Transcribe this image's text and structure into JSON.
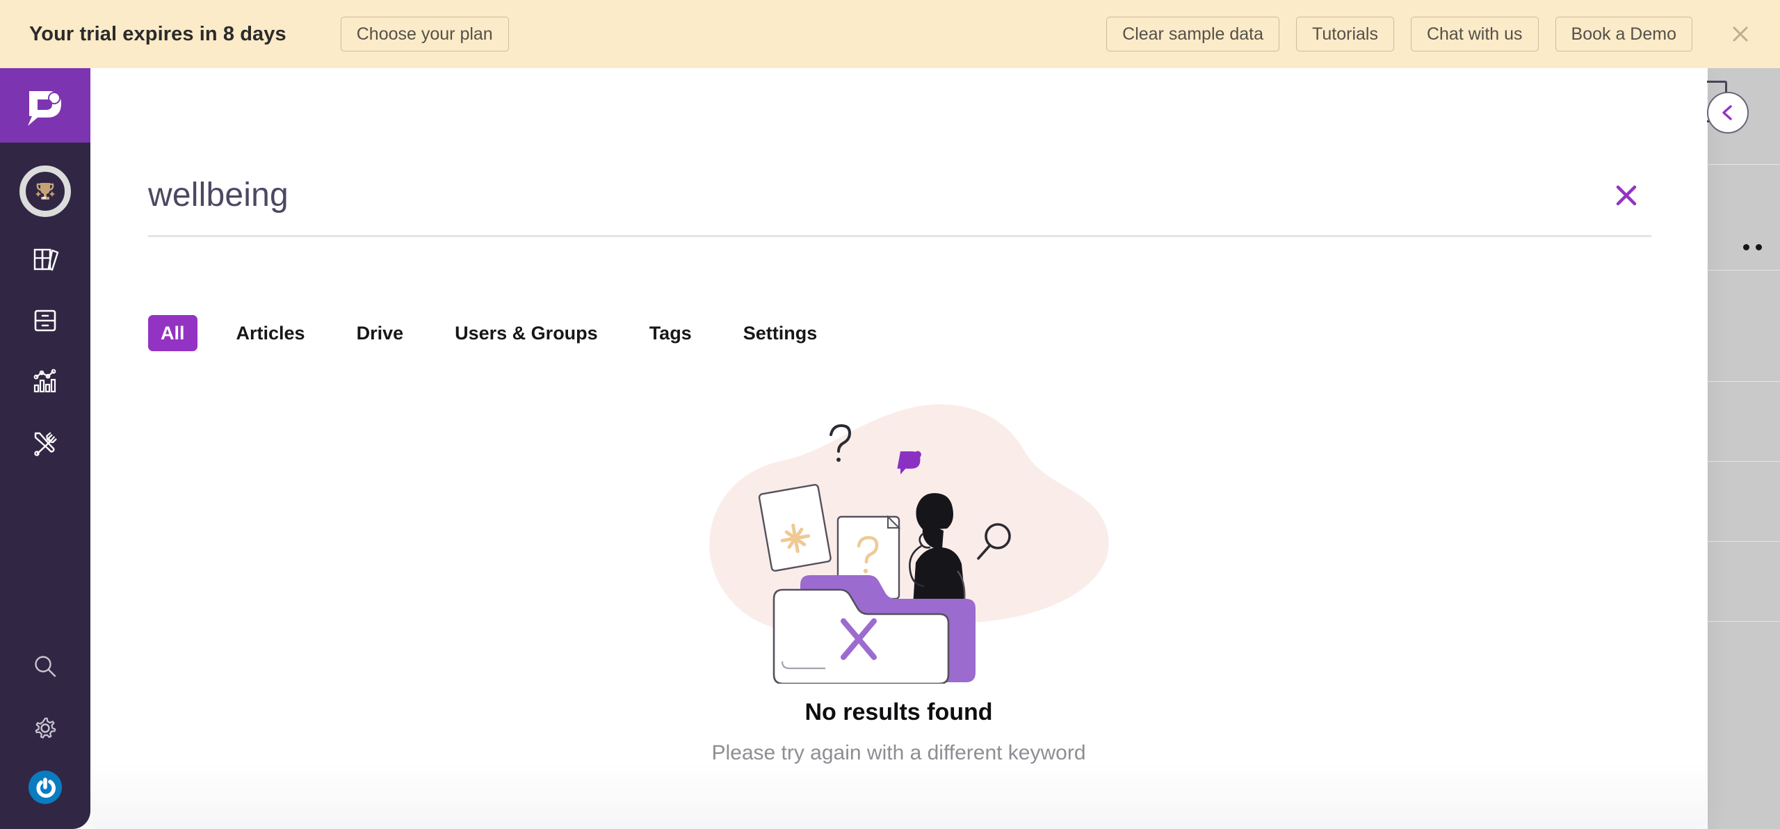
{
  "banner": {
    "message": "Your trial expires in 8 days",
    "plan_button": "Choose your plan",
    "actions": [
      {
        "label": "Clear sample data",
        "name": "clear-sample-data-button"
      },
      {
        "label": "Tutorials",
        "name": "tutorials-button"
      },
      {
        "label": "Chat with us",
        "name": "chat-with-us-button"
      },
      {
        "label": "Book a Demo",
        "name": "book-a-demo-button"
      }
    ],
    "close_icon": "close-icon",
    "background_color": "#FCEBC8",
    "border_color": "#CDBB99"
  },
  "sidebar": {
    "logo_icon": "document360-logo-icon",
    "logo_background": "#7D34B0",
    "background_color": "#312744",
    "badge": {
      "icon": "trophy-icon",
      "ring_color": "#DCDCDC"
    },
    "items": [
      {
        "icon": "books-icon",
        "name": "sidebar-item-documentation"
      },
      {
        "icon": "drive-cabinet-icon",
        "name": "sidebar-item-drive"
      },
      {
        "icon": "analytics-chart-icon",
        "name": "sidebar-item-analytics"
      },
      {
        "icon": "tools-icon",
        "name": "sidebar-item-tools"
      }
    ],
    "bottom_items": [
      {
        "icon": "search-icon",
        "name": "sidebar-item-search"
      },
      {
        "icon": "gear-icon",
        "name": "sidebar-item-settings"
      }
    ],
    "avatar": {
      "icon": "power-avatar-icon",
      "color": "#0A7CC0"
    }
  },
  "search": {
    "value": "wellbeing",
    "placeholder": "Search",
    "clear_icon": "close-icon",
    "clear_color": "#9333C4"
  },
  "tabs": [
    {
      "label": "All",
      "active": true
    },
    {
      "label": "Articles",
      "active": false
    },
    {
      "label": "Drive",
      "active": false
    },
    {
      "label": "Users & Groups",
      "active": false
    },
    {
      "label": "Tags",
      "active": false
    },
    {
      "label": "Settings",
      "active": false
    }
  ],
  "tabs_accent_color": "#9333C4",
  "empty_state": {
    "illustration": "no-results-folder-illustration",
    "title": "No results found",
    "subtitle": "Please try again with a different keyword",
    "blob_color": "#FAEDE9",
    "folder_accent": "#9B6BD0"
  },
  "collapse": {
    "icon": "chevron-left-icon",
    "color": "#9333C4"
  }
}
